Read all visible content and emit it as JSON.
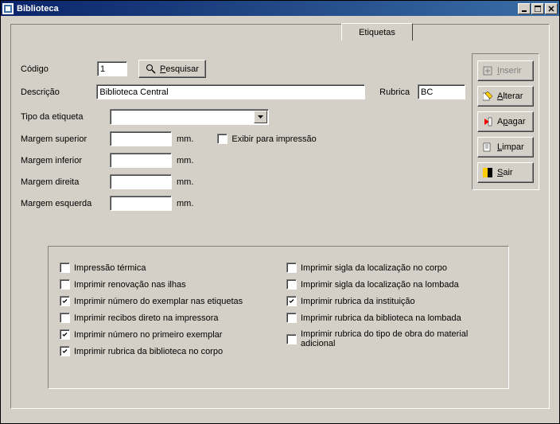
{
  "window": {
    "title": "Biblioteca"
  },
  "tab": {
    "label": "Etiquetas"
  },
  "form": {
    "codigo_label": "Código",
    "codigo_value": "1",
    "pesquisar_prefix": "P",
    "pesquisar_rest": "esquisar",
    "descricao_label": "Descrição",
    "descricao_value": "Biblioteca Central",
    "rubrica_label": "Rubrica",
    "rubrica_value": "BC",
    "tipo_label": "Tipo da etiqueta",
    "tipo_value": "",
    "margem_sup_label": "Margem superior",
    "margem_inf_label": "Margem inferior",
    "margem_dir_label": "Margem direita",
    "margem_esq_label": "Margem esquerda",
    "mm": "mm.",
    "exibir_label": "Exibir para impressão",
    "margem_sup_value": "",
    "margem_inf_value": "",
    "margem_dir_value": "",
    "margem_esq_value": ""
  },
  "buttons": {
    "inserir_u": "I",
    "inserir_rest": "nserir",
    "alterar_u": "A",
    "alterar_rest": "lterar",
    "apagar_pre": "A",
    "apagar_u": "p",
    "apagar_rest": "agar",
    "limpar_u": "L",
    "limpar_rest": "impar",
    "sair_u": "S",
    "sair_rest": "air"
  },
  "checks": {
    "left": [
      {
        "label": "Impressão térmica",
        "checked": false
      },
      {
        "label": "Imprimir renovação nas ilhas",
        "checked": false
      },
      {
        "label": "Imprimir número do exemplar nas etiquetas",
        "checked": true
      },
      {
        "label": "Imprimir recibos direto na impressora",
        "checked": false
      },
      {
        "label": "Imprimir número no primeiro exemplar",
        "checked": true
      },
      {
        "label": "Imprimir rubrica da biblioteca no corpo",
        "checked": true
      }
    ],
    "right": [
      {
        "label": "Imprimir sigla da localização no corpo",
        "checked": false
      },
      {
        "label": "Imprimir sigla da localização na lombada",
        "checked": false
      },
      {
        "label": "Imprimir rubrica da instituição",
        "checked": true
      },
      {
        "label": "Imprimir rubrica da biblioteca na lombada",
        "checked": false
      },
      {
        "label": "Imprimir rubrica do tipo de obra do material adicional",
        "checked": false
      }
    ]
  }
}
